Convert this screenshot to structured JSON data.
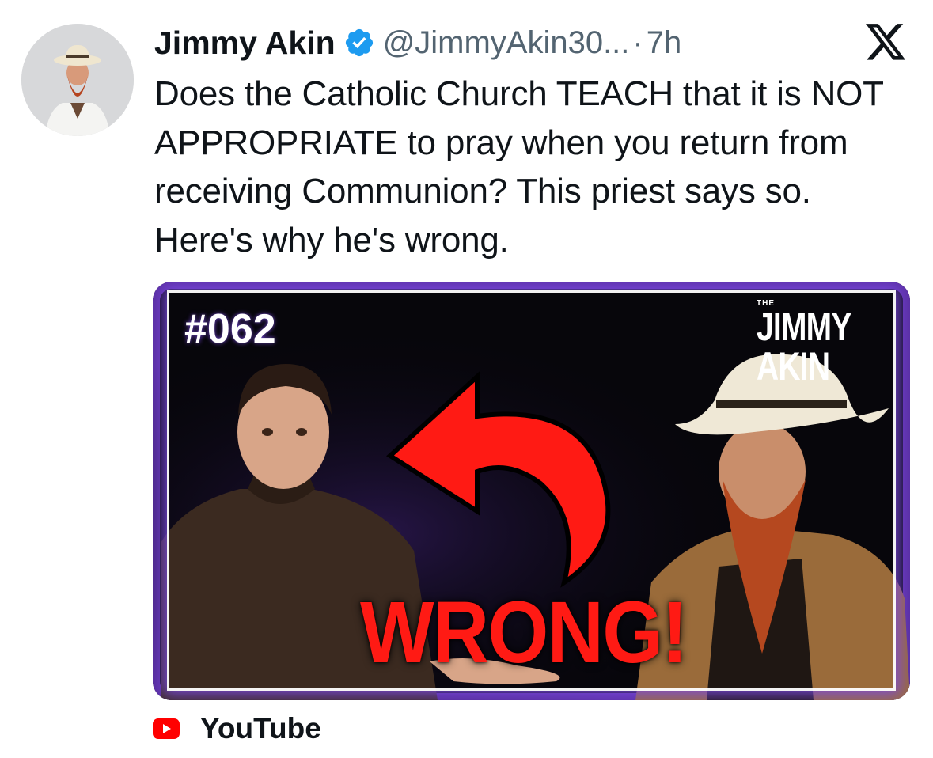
{
  "tweet": {
    "author_name": "Jimmy Akin",
    "handle": "@JimmyAkin30...",
    "separator": "·",
    "time": "7h",
    "text": "Does the Catholic Church TEACH that it is NOT APPROPRIATE to pray when you return from receiving Communion? This priest says so. Here's why he's wrong.",
    "icons": {
      "verified": "verified-badge-icon",
      "platform": "x-logo-icon"
    },
    "colors": {
      "verified": "#1d9bf0",
      "secondary_text": "#536471",
      "text": "#0f1419"
    }
  },
  "card": {
    "thumbnail": {
      "episode": "#062",
      "brand_small": "THE",
      "brand_name": "JIMMY AKIN",
      "headline": "WRONG!",
      "colors": {
        "frame": "#5a2fa2",
        "arrow": "#ff1a14",
        "headline": "#ff1a14"
      }
    },
    "source": {
      "icon": "youtube-icon",
      "label": "YouTube",
      "icon_color": "#ff0000"
    }
  }
}
